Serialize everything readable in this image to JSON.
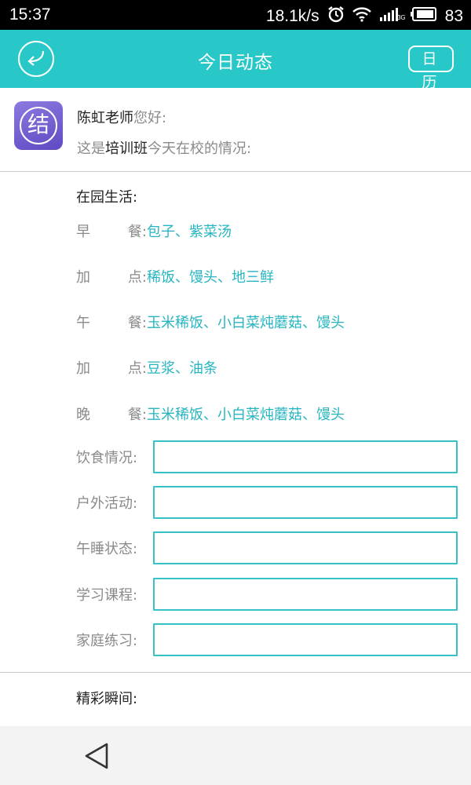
{
  "status_bar": {
    "time": "15:37",
    "network_speed": "18.1k/s",
    "network_type": "3G",
    "battery": "83",
    "icons": [
      "alarm-icon",
      "wifi-icon",
      "signal-icon",
      "battery-icon"
    ]
  },
  "header": {
    "title": "今日动态",
    "calendar_label": "日 历",
    "back_icon": "back-arrow-icon"
  },
  "greeting": {
    "logo_char": "结",
    "teacher_name": "陈虹老师",
    "hello_suffix": "您好:",
    "line2_prefix": "这是",
    "class_name": "培训班",
    "line2_suffix": "今天在校的情况:"
  },
  "life": {
    "title": "在园生活:",
    "meals": [
      {
        "label_a": "早",
        "label_b": "餐:",
        "value": "包子、紫菜汤"
      },
      {
        "label_a": "加",
        "label_b": "点:",
        "value": "稀饭、馒头、地三鲜"
      },
      {
        "label_a": "午",
        "label_b": "餐:",
        "value": "玉米稀饭、小白菜炖蘑菇、馒头"
      },
      {
        "label_a": "加",
        "label_b": "点:",
        "value": "豆浆、油条"
      },
      {
        "label_a": "晚",
        "label_b": "餐:",
        "value": "玉米稀饭、小白菜炖蘑菇、馒头"
      }
    ],
    "fields": [
      {
        "label": "饮食情况:",
        "value": ""
      },
      {
        "label": "户外活动:",
        "value": ""
      },
      {
        "label": "午睡状态:",
        "value": ""
      },
      {
        "label": "学习课程:",
        "value": ""
      },
      {
        "label": "家庭练习:",
        "value": ""
      }
    ]
  },
  "moments": {
    "title": "精彩瞬间:"
  },
  "colors": {
    "accent": "#28c8c9",
    "value_text": "#27b5c0",
    "input_border": "#38c2c7"
  }
}
